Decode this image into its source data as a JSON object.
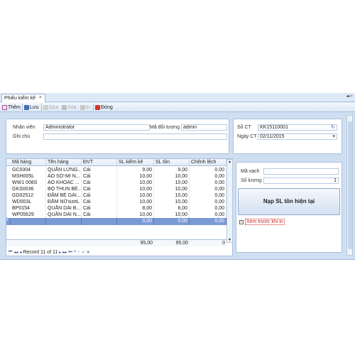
{
  "tab": {
    "label": "Phiếu kiểm kê",
    "close": "×"
  },
  "tabbar_right": "◂▸×",
  "toolbar": {
    "them": "Thêm",
    "luu": "Lưu",
    "sua": "Sửa",
    "xoa": "Xóa",
    "in": "In",
    "dong": "Đóng"
  },
  "header": {
    "nhan_vien_label": "Nhân viên",
    "nhan_vien_value": "Administrator",
    "ma_doi_tuong_label": "Mã đối tượng",
    "ma_doi_tuong_value": "admin",
    "ghi_chu_label": "Ghi chú",
    "ghi_chu_value": "",
    "so_ct_label": "Số CT",
    "so_ct_value": "KK15110001",
    "ngay_ct_label": "Ngày CT",
    "ngay_ct_value": "02/11/2015"
  },
  "grid": {
    "columns": [
      "Mã hàng",
      "Tên hàng",
      "ĐVT",
      "SL kiểm kê",
      "SL tồn",
      "Chênh lệch"
    ],
    "rows": [
      [
        "GC0304",
        "QUẦN LỬNG...",
        "Cái",
        "9,00",
        "9,00",
        "0,00"
      ],
      [
        "MSH005L",
        "ÁO SƠ-MI N...",
        "Cái",
        "10,00",
        "10,00",
        "0,00"
      ],
      [
        "WW1 008S",
        "ÁO KHOÁC ...",
        "Cái",
        "10,00",
        "10,00",
        "0,00"
      ],
      [
        "GKS0036",
        "BỘ THUN BÉ...",
        "Cái",
        "10,00",
        "10,00",
        "0,00"
      ],
      [
        "GD02512",
        "ĐẦM BÉ GÁI...",
        "Cái",
        "10,00",
        "10,00",
        "0,00"
      ],
      [
        "WD003L",
        "ĐẦM NỮsizeL",
        "Cái",
        "10,00",
        "10,00",
        "0,00"
      ],
      [
        "BP0154",
        "QUẦN DÀI B...",
        "Cái",
        "8,00",
        "8,00",
        "0,00"
      ],
      [
        "WP05629",
        "QUẦN DÀI N...",
        "Cái",
        "10,00",
        "10,00",
        "0,00"
      ]
    ],
    "new_row": [
      "",
      "",
      "",
      "0,00",
      "0,00",
      "0,00"
    ],
    "new_row_marker": "*",
    "totals": {
      "sl_kiem_ke": "95,00",
      "sl_ton": "95,00",
      "chenh_lech": "0"
    },
    "record_text": "Record 11 of 11"
  },
  "side": {
    "ma_vach_label": "Mã vạch",
    "ma_vach_value": "",
    "so_luong_label": "Số lượng",
    "so_luong_value": "1",
    "nap_button": "Nạp SL tồn hiện tại",
    "xem_truoc_label": "Xem trước khi in",
    "xem_truoc_checked": true
  },
  "colors": {
    "accent": "#7a9ad6",
    "workspace": "#cfdff2",
    "border": "#a9bfdb"
  }
}
